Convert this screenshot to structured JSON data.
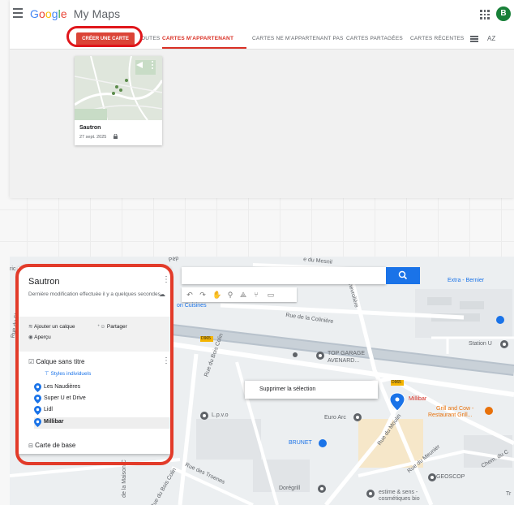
{
  "mymaps": {
    "app_name": "My Maps",
    "logo": [
      "G",
      "o",
      "o",
      "g",
      "l",
      "e"
    ],
    "avatar": "B",
    "create_button": "CRÉER UNE CARTE",
    "tabs": {
      "all": "OUTES",
      "mine": "CARTES M'APPARTENANT",
      "not_mine": "CARTES NE M'APPARTENANT PAS",
      "shared": "CARTES PARTAGÉES",
      "recent": "CARTES RÉCENTES"
    },
    "sort_label": "AZ",
    "card": {
      "title": "Sautron",
      "date": "27 sept. 2025"
    }
  },
  "editor": {
    "map_title": "Sautron",
    "description": "Dernière modification effectuée il y a quelques secondes",
    "actions": {
      "add_layer": "Ajouter un calque",
      "share": "Partager",
      "preview": "Aperçu"
    },
    "layer": {
      "name": "Calque sans titre",
      "style": "Styles individuels"
    },
    "places": [
      {
        "name": "Les Naudières"
      },
      {
        "name": "Super U et Drive"
      },
      {
        "name": "Lidl"
      },
      {
        "name": "Millibar"
      }
    ],
    "base_map": "Carte de base",
    "context_menu": "Supprimer la sélection",
    "pin_color": "#1a73e8",
    "map_labels": {
      "extra": "Extra - Bernier",
      "cuisines": "on Cuisines",
      "colin": "Rue de la Colinière",
      "chevroliere": "Chevrolière",
      "top_garage": "TOP GARAGE",
      "avenard": "AVENARD...",
      "station": "Station U",
      "d965a": "D965",
      "d965b": "D965",
      "lpvo": "L.p.v.o",
      "euro_arc": "Euro Arc",
      "millibar": "Millibar",
      "grill": "Grill and Cow -",
      "grill2": "Restaurant Grill...",
      "brunet": "BRUNET",
      "bois_colin": "Rue du Bois Colin",
      "bois_colin2": "Rue du Bois Colin",
      "moulin": "Rue du Moulin",
      "meunier": "Rue du Meunier",
      "troenes": "Rue des Troenes",
      "maison": "de la Maison C",
      "doregrill": "Dorégrill",
      "geoscop": "GEOSCOP",
      "estime": "estime & sens -",
      "estime2": "cosmétiques bio",
      "mesnil": "e du Mesnil",
      "rue_fleur": "Rue du Fle",
      "ric": "ric",
      "chem": "Chem. du C",
      "pep": "Pép",
      "tr": "Tr"
    }
  }
}
